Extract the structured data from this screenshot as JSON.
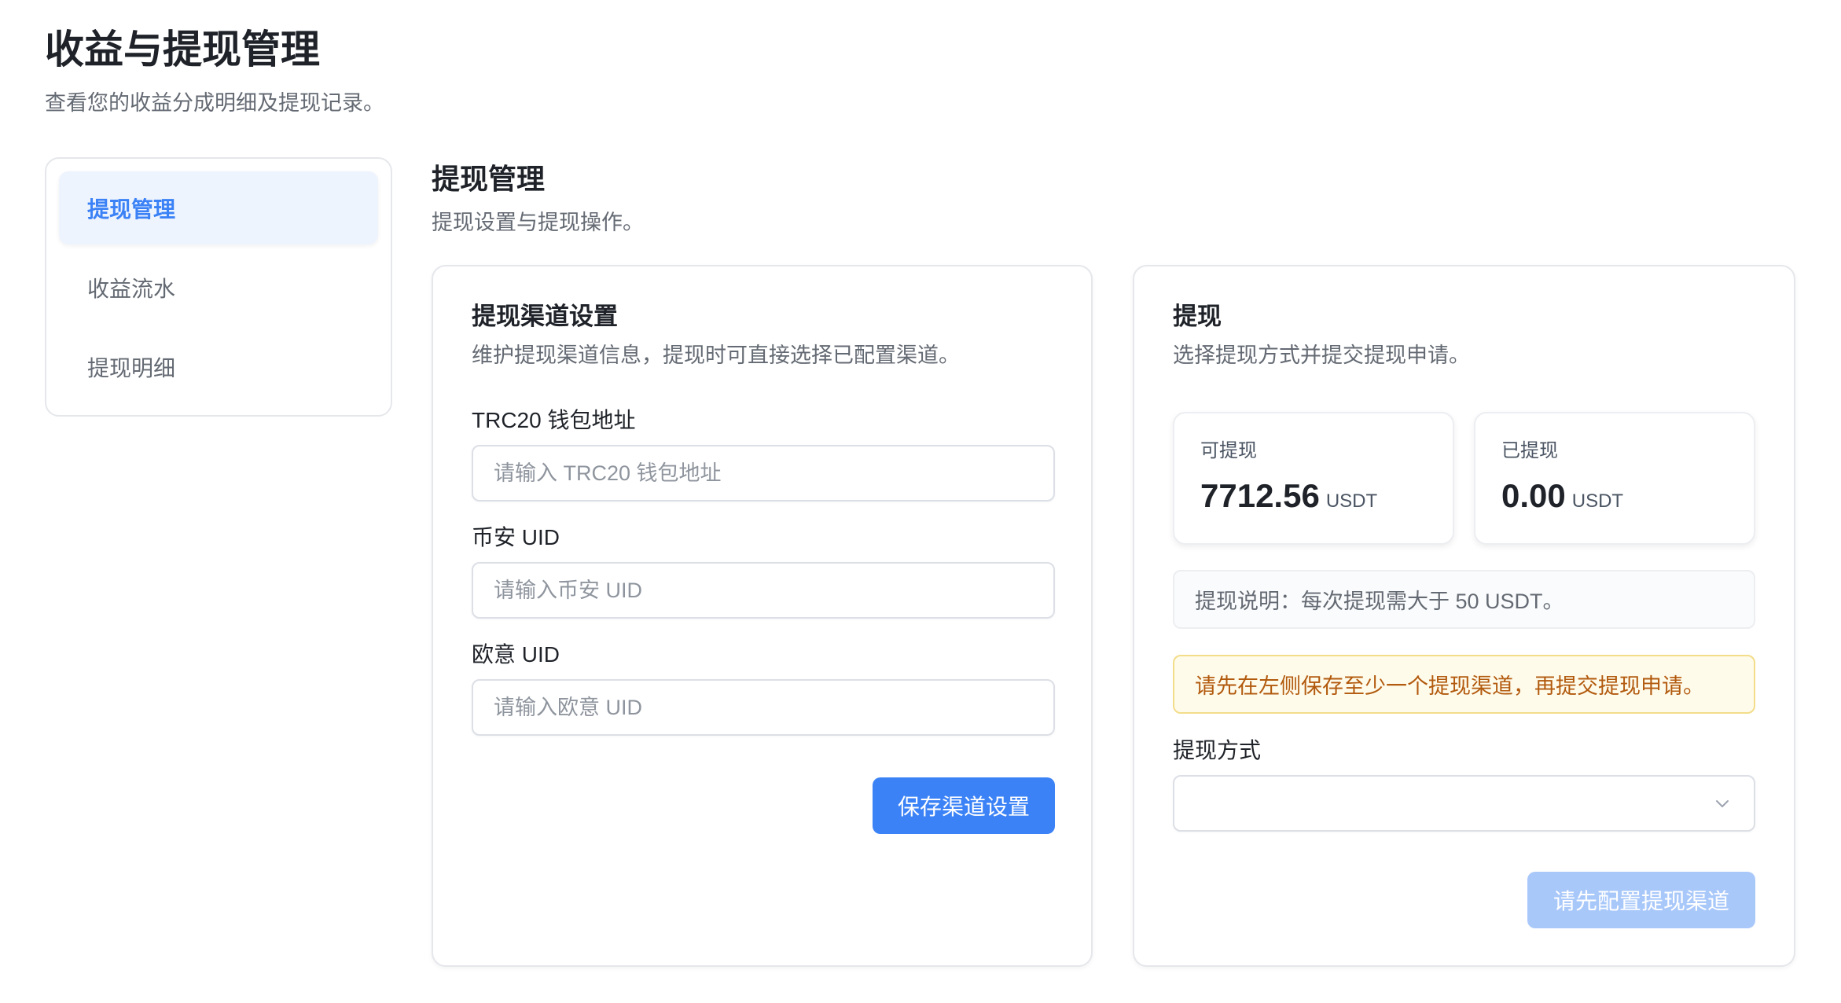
{
  "header": {
    "title": "收益与提现管理",
    "subtitle": "查看您的收益分成明细及提现记录。"
  },
  "sidebar": {
    "items": [
      {
        "label": "提现管理",
        "active": true
      },
      {
        "label": "收益流水",
        "active": false
      },
      {
        "label": "提现明细",
        "active": false
      }
    ]
  },
  "section": {
    "title": "提现管理",
    "subtitle": "提现设置与提现操作。"
  },
  "channel_card": {
    "title": "提现渠道设置",
    "description": "维护提现渠道信息，提现时可直接选择已配置渠道。",
    "fields": [
      {
        "label": "TRC20 钱包地址",
        "placeholder": "请输入 TRC20 钱包地址",
        "value": ""
      },
      {
        "label": "币安 UID",
        "placeholder": "请输入币安 UID",
        "value": ""
      },
      {
        "label": "欧意 UID",
        "placeholder": "请输入欧意 UID",
        "value": ""
      }
    ],
    "save_label": "保存渠道设置"
  },
  "withdraw_card": {
    "title": "提现",
    "description": "选择提现方式并提交提现申请。",
    "available": {
      "label": "可提现",
      "value": "7712.56",
      "unit": "USDT"
    },
    "withdrawn": {
      "label": "已提现",
      "value": "0.00",
      "unit": "USDT"
    },
    "note": "提现说明：每次提现需大于 50 USDT。",
    "warning": "请先在左侧保存至少一个提现渠道，再提交提现申请。",
    "method_label": "提现方式",
    "method_value": "",
    "submit_label": "请先配置提现渠道"
  },
  "colors": {
    "primary": "#3b82f6",
    "primary_disabled": "#a9c8fa",
    "warning_text": "#b25a0e",
    "warning_bg": "#fffbea",
    "active_bg": "#eef4fe"
  }
}
